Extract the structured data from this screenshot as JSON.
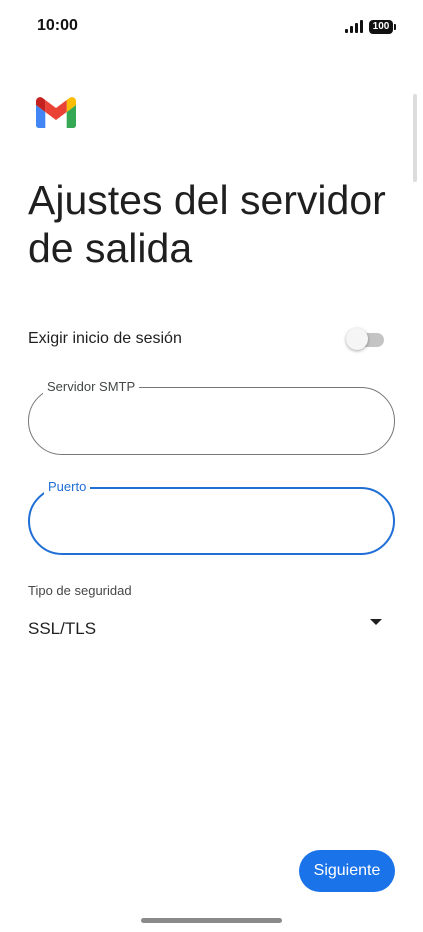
{
  "status_bar": {
    "time": "10:00",
    "battery": "100"
  },
  "logo": {
    "icon": "gmail-icon",
    "colors": {
      "blue": "#4285F4",
      "red": "#EA4335",
      "yellow": "#FBBC04",
      "green": "#34A853",
      "dark_red": "#C5221F"
    }
  },
  "page": {
    "title": "Ajustes del servidor de salida"
  },
  "login_toggle": {
    "label": "Exigir inicio de sesión",
    "checked": false
  },
  "smtp_field": {
    "label": "Servidor SMTP",
    "value": ""
  },
  "port_field": {
    "label": "Puerto",
    "value": "",
    "focused": true
  },
  "security": {
    "caption": "Tipo de seguridad",
    "selected": "SSL/TLS",
    "icon": "dropdown-arrow-icon"
  },
  "actions": {
    "next_label": "Siguiente"
  },
  "colors": {
    "accent": "#1A73E8",
    "focus": "#1F6FD6",
    "outline": "#747775",
    "text": "#1F1F1F"
  }
}
